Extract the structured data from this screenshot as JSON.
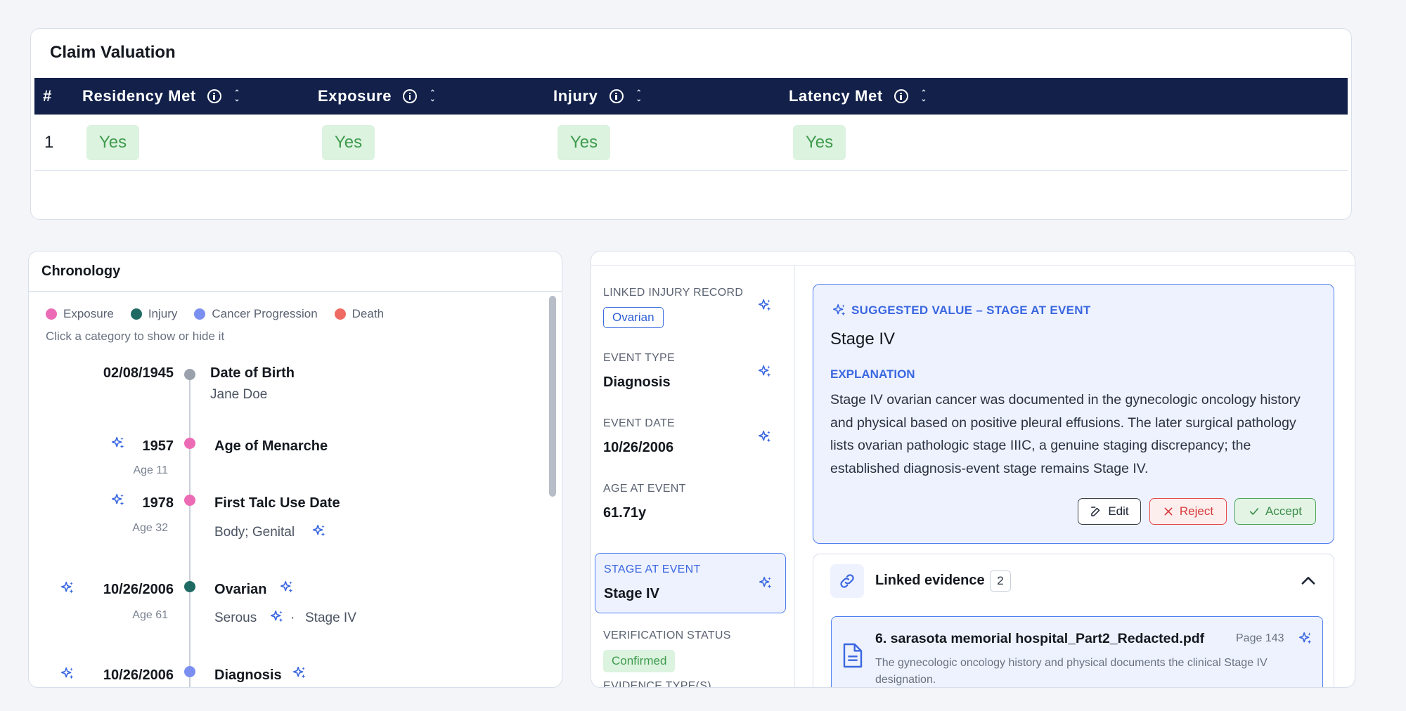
{
  "claim": {
    "title": "Claim Valuation",
    "columns": [
      "#",
      "Residency Met",
      "Exposure",
      "Injury",
      "Latency Met"
    ],
    "rows": [
      {
        "num": "1",
        "residency": "Yes",
        "exposure": "Yes",
        "injury": "Yes",
        "latency": "Yes"
      }
    ]
  },
  "chronology": {
    "title": "Chronology",
    "legend": [
      {
        "label": "Exposure",
        "color": "#ec6bb5"
      },
      {
        "label": "Injury",
        "color": "#1f6b64"
      },
      {
        "label": "Cancer Progression",
        "color": "#7b8ff0"
      },
      {
        "label": "Death",
        "color": "#ef6a62"
      }
    ],
    "hint": "Click a category to show or hide it",
    "events": [
      {
        "date": "02/08/1945",
        "age": "",
        "title": "Date of Birth",
        "sub": "Jane Doe",
        "color": "#9aa1ad"
      },
      {
        "date": "1957",
        "age": "Age 11",
        "title": "Age of Menarche",
        "sub": "",
        "color": "#ec6bb5"
      },
      {
        "date": "1978",
        "age": "Age 32",
        "title": "First Talc Use Date",
        "sub": "Body; Genital",
        "color": "#ec6bb5"
      },
      {
        "date": "10/26/2006",
        "age": "Age 61",
        "title": "Ovarian",
        "sub": "Serous",
        "sub2": "Stage IV",
        "color": "#1f6b64"
      },
      {
        "date": "10/26/2006",
        "age": "",
        "title": "Diagnosis",
        "sub": "",
        "color": "#7b8ff0"
      }
    ]
  },
  "detail": {
    "fields": {
      "linked_injury_label": "LINKED INJURY RECORD",
      "linked_injury_value": "Ovarian",
      "event_type_label": "EVENT TYPE",
      "event_type_value": "Diagnosis",
      "event_date_label": "EVENT DATE",
      "event_date_value": "10/26/2006",
      "age_label": "AGE AT EVENT",
      "age_value": "61.71y",
      "stage_label": "STAGE AT EVENT",
      "stage_value": "Stage IV",
      "verification_label": "VERIFICATION STATUS",
      "verification_value": "Confirmed",
      "evidence_type_label": "EVIDENCE TYPE(S)"
    },
    "suggestion": {
      "header": "SUGGESTED VALUE – STAGE AT EVENT",
      "value": "Stage IV",
      "explanation_label": "EXPLANATION",
      "explanation": "Stage IV ovarian cancer was documented in the gynecologic oncology history and physical based on positive pleural effusions. The later surgical pathology lists ovarian pathologic stage IIIC, a genuine staging discrepancy; the established diagnosis-event stage remains Stage IV.",
      "edit_label": "Edit",
      "reject_label": "Reject",
      "accept_label": "Accept"
    },
    "evidence": {
      "label": "Linked evidence",
      "count": "2",
      "doc_name": "6. sarasota memorial hospital_Part2_Redacted.pdf",
      "doc_page": "Page 143",
      "doc_desc": "The gynecologic oncology history and physical documents the clinical Stage IV designation."
    }
  },
  "colors": {
    "accent": "#3a67e0",
    "header_navy": "#12204a",
    "yes_bg": "#dcf3df",
    "yes_text": "#3f9b4e"
  }
}
